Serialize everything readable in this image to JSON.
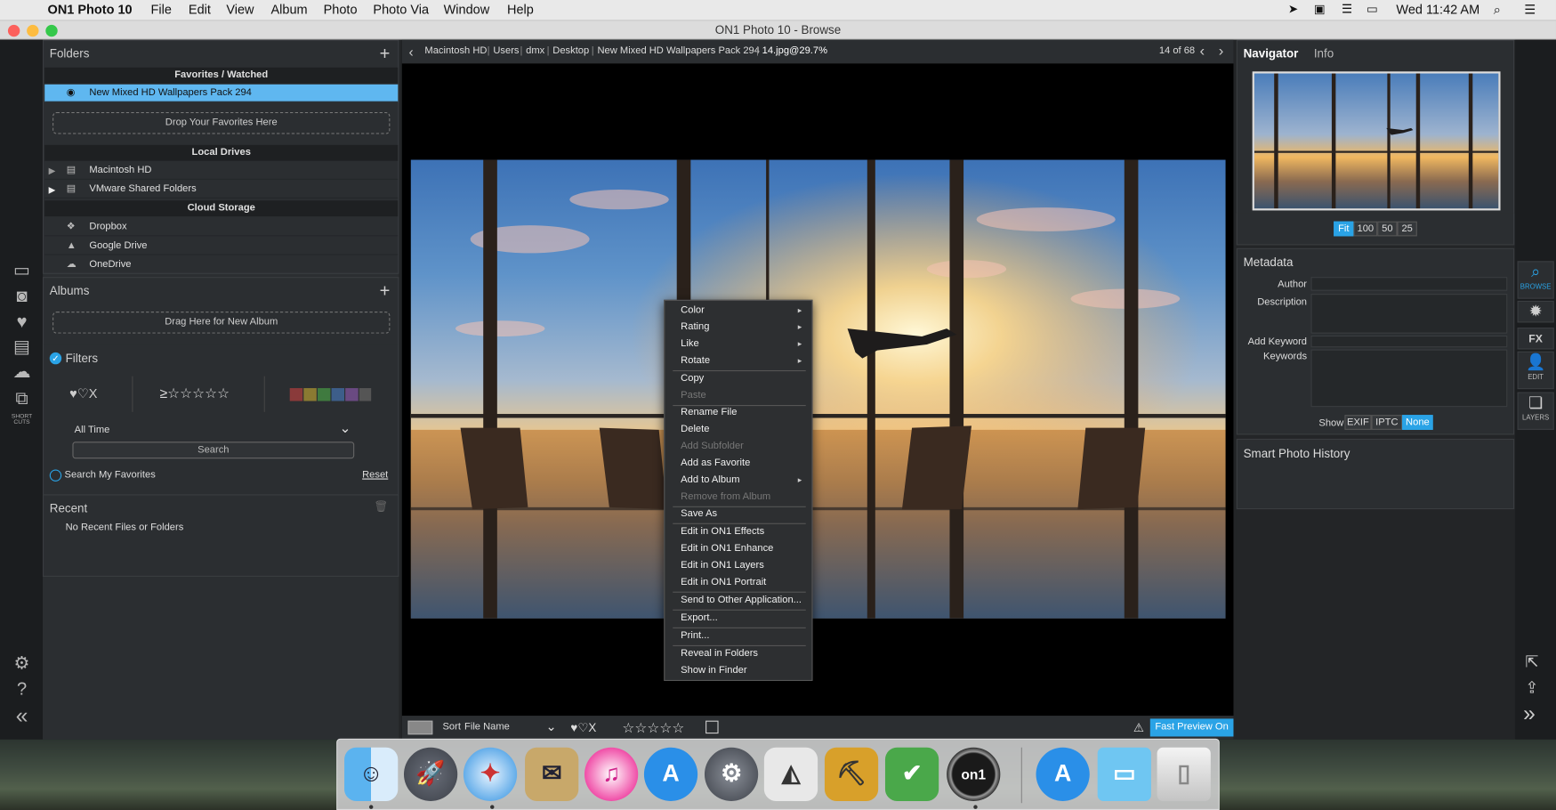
{
  "menubar": {
    "app_name": "ON1 Photo 10",
    "menus": [
      "File",
      "Edit",
      "View",
      "Album",
      "Photo",
      "Photo Via",
      "Window",
      "Help"
    ],
    "clock": "Wed 11:42 AM"
  },
  "window": {
    "title": "ON1 Photo 10 - Browse"
  },
  "left": {
    "folders": {
      "title": "Folders",
      "favorites_band": "Favorites / Watched",
      "selected_favorite": "New Mixed HD Wallpapers Pack 294",
      "drop_favorites": "Drop Your Favorites Here",
      "local_band": "Local Drives",
      "local_drives": [
        "Macintosh HD",
        "VMware Shared Folders"
      ],
      "cloud_band": "Cloud Storage",
      "cloud": [
        "Dropbox",
        "Google Drive",
        "OneDrive"
      ]
    },
    "albums": {
      "title": "Albums",
      "drop_album": "Drag Here for New Album"
    },
    "filters": {
      "title": "Filters",
      "like_glyphs": "♥♡X",
      "rating_glyphs": "≥☆☆☆☆☆",
      "color_swatches": [
        "#8a3a3a",
        "#8a7a32",
        "#3f7a3f",
        "#3d5e8a",
        "#6a4a82",
        "#555555"
      ],
      "time": "All Time",
      "search_label": "Search",
      "search_favorites": "Search My Favorites",
      "reset": "Reset"
    },
    "recent": {
      "title": "Recent",
      "empty": "No Recent Files or Folders"
    },
    "shortcuts_label": "SHORT CUTS"
  },
  "path": {
    "crumbs": [
      "Macintosh HD",
      "Users",
      "dmx",
      "Desktop",
      "New Mixed HD Wallpapers Pack 294"
    ],
    "file": "14.jpg@29.7%",
    "counter": "14 of 68"
  },
  "bottombar": {
    "sort_label": "Sort",
    "sort_value": "File Name",
    "like_glyphs": "♥♡X",
    "stars": "☆☆☆☆☆",
    "fast_preview": "Fast Preview On"
  },
  "context_menu": {
    "items": [
      {
        "label": "Color",
        "submenu": true
      },
      {
        "label": "Rating",
        "submenu": true
      },
      {
        "label": "Like",
        "submenu": true
      },
      {
        "label": "Rotate",
        "submenu": true
      },
      {
        "label": "Copy"
      },
      {
        "label": "Paste",
        "disabled": true
      },
      {
        "label": "Rename File"
      },
      {
        "label": "Delete"
      },
      {
        "label": "Add Subfolder",
        "disabled": true
      },
      {
        "label": "Add as Favorite"
      },
      {
        "label": "Add to Album",
        "submenu": true
      },
      {
        "label": "Remove from Album",
        "disabled": true
      },
      {
        "label": "Save As"
      },
      {
        "label": "Edit in ON1 Effects"
      },
      {
        "label": "Edit in ON1 Enhance"
      },
      {
        "label": "Edit in ON1 Layers"
      },
      {
        "label": "Edit in ON1 Portrait"
      },
      {
        "label": "Send to Other Application..."
      },
      {
        "label": "Export..."
      },
      {
        "label": "Print..."
      },
      {
        "label": "Reveal in Folders"
      },
      {
        "label": "Show in Finder"
      }
    ]
  },
  "right": {
    "tabs": [
      "Navigator",
      "Info"
    ],
    "zoom": [
      "Fit",
      "100",
      "50",
      "25"
    ],
    "metadata": {
      "title": "Metadata",
      "author": "Author",
      "description": "Description",
      "add_keyword": "Add Keyword",
      "keywords": "Keywords",
      "show": "Show",
      "show_options": [
        "EXIF",
        "IPTC",
        "None"
      ]
    },
    "history_title": "Smart Photo History"
  },
  "module_strip": {
    "browse": "BROWSE",
    "edit": "EDIT",
    "layers": "LAYERS",
    "fx": "FX"
  }
}
